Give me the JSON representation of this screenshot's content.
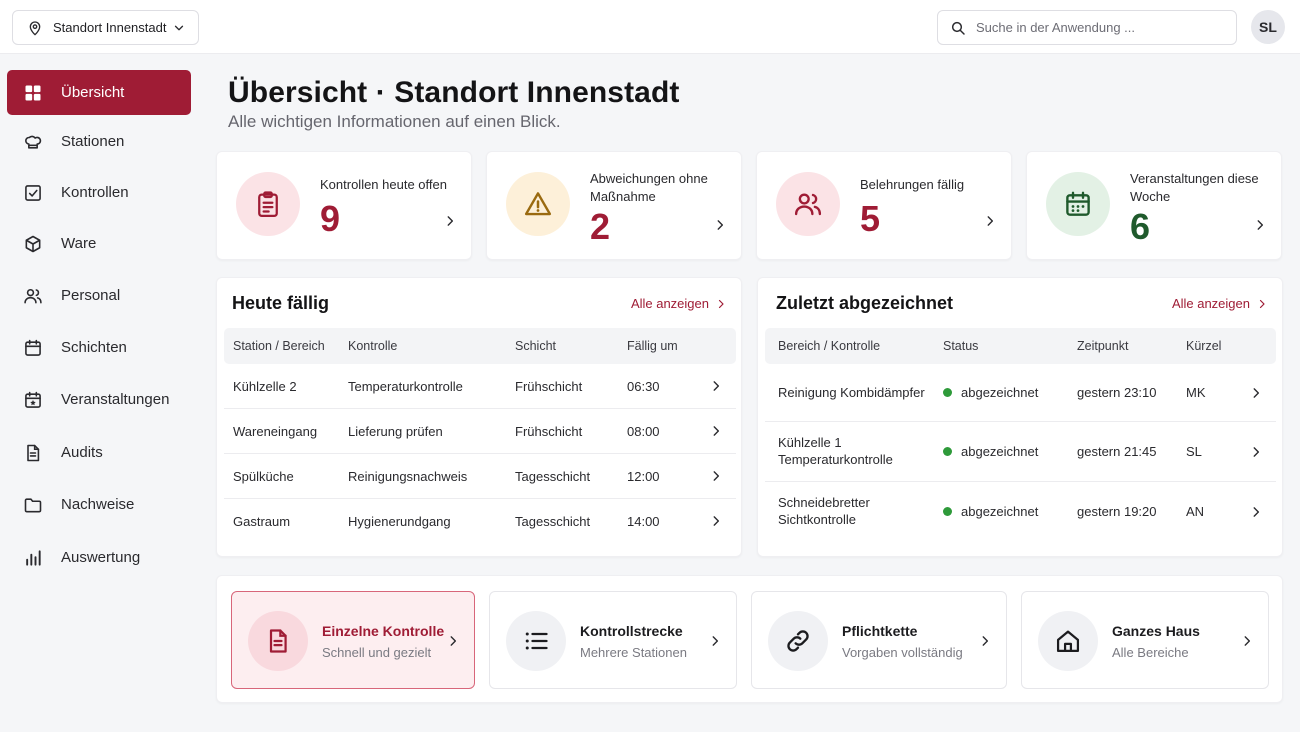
{
  "topbar": {
    "location_label": "Standort Innenstadt",
    "search_placeholder": "Suche in der Anwendung ...",
    "avatar_initials": "SL"
  },
  "sidebar": {
    "items": [
      {
        "label": "Übersicht",
        "icon": "dashboard-grid-icon",
        "active": true
      },
      {
        "label": "Stationen",
        "icon": "chef-hat-icon"
      },
      {
        "label": "Kontrollen",
        "icon": "checkbox-icon"
      },
      {
        "label": "Ware",
        "icon": "box-icon"
      },
      {
        "label": "Personal",
        "icon": "users-icon"
      },
      {
        "label": "Schichten",
        "icon": "calendar-icon"
      },
      {
        "label": "Veranstaltungen",
        "icon": "calendar-star-icon"
      },
      {
        "label": "Audits",
        "icon": "document-icon"
      },
      {
        "label": "Nachweise",
        "icon": "folder-icon"
      },
      {
        "label": "Auswertung",
        "icon": "bar-chart-icon"
      }
    ]
  },
  "header": {
    "title": "Übersicht · Standort Innenstadt",
    "subtitle": "Alle wichtigen Informationen auf einen Blick."
  },
  "kpis": [
    {
      "label": "Kontrollen heute offen",
      "value": "9",
      "icon": "clipboard-icon",
      "color": "#9f1c35",
      "bg": "#fbe3e6"
    },
    {
      "label": "Abweichungen ohne Maßnahme",
      "value": "2",
      "icon": "warning-icon",
      "color": "#9f1c35",
      "bg": "#fdf0d9"
    },
    {
      "label": "Belehrungen fällig",
      "value": "5",
      "icon": "users-icon",
      "color": "#9f1c35",
      "bg": "#fbe3e6"
    },
    {
      "label": "Veranstaltungen diese Woche",
      "value": "6",
      "icon": "calendar-icon",
      "color": "#1f5a2c",
      "bg": "#e3f1e5"
    }
  ],
  "due_today": {
    "title": "Heute fällig",
    "show_all": "Alle anzeigen",
    "columns": [
      "Station / Bereich",
      "Kontrolle",
      "Schicht",
      "Fällig um"
    ],
    "rows": [
      [
        "Kühlzelle 2",
        "Temperaturkontrolle",
        "Frühschicht",
        "06:30"
      ],
      [
        "Wareneingang",
        "Lieferung prüfen",
        "Frühschicht",
        "08:00"
      ],
      [
        "Spülküche",
        "Reinigungsnachweis",
        "Tagesschicht",
        "12:00"
      ],
      [
        "Gastraum",
        "Hygienerundgang",
        "Tagesschicht",
        "14:00"
      ]
    ]
  },
  "recent": {
    "title": "Zuletzt abgezeichnet",
    "show_all": "Alle anzeigen",
    "columns": [
      "Bereich / Kontrolle",
      "Status",
      "Zeitpunkt",
      "Kürzel"
    ],
    "status_color": "#2e9a3a",
    "rows": [
      {
        "area": "Reinigung Kombidämpfer",
        "status": "abgezeichnet",
        "time": "gestern 23:10",
        "initials": "MK"
      },
      {
        "area": "Kühlzelle 1\nTemperaturkontrolle",
        "status": "abgezeichnet",
        "time": "gestern 21:45",
        "initials": "SL"
      },
      {
        "area": "Schneidebretter\nSichtkontrolle",
        "status": "abgezeichnet",
        "time": "gestern 19:20",
        "initials": "AN"
      }
    ]
  },
  "actions": [
    {
      "title": "Einzelne Kontrolle",
      "subtitle": "Schnell und gezielt",
      "icon": "document-icon",
      "primary": true
    },
    {
      "title": "Kontrollstrecke",
      "subtitle": "Mehrere Stationen",
      "icon": "list-icon"
    },
    {
      "title": "Pflichtkette",
      "subtitle": "Vorgaben vollständig",
      "icon": "link-icon"
    },
    {
      "title": "Ganzes Haus",
      "subtitle": "Alle Bereiche",
      "icon": "house-icon"
    }
  ],
  "colors": {
    "brand": "#9f1c35",
    "text": "#1c1c1f"
  }
}
